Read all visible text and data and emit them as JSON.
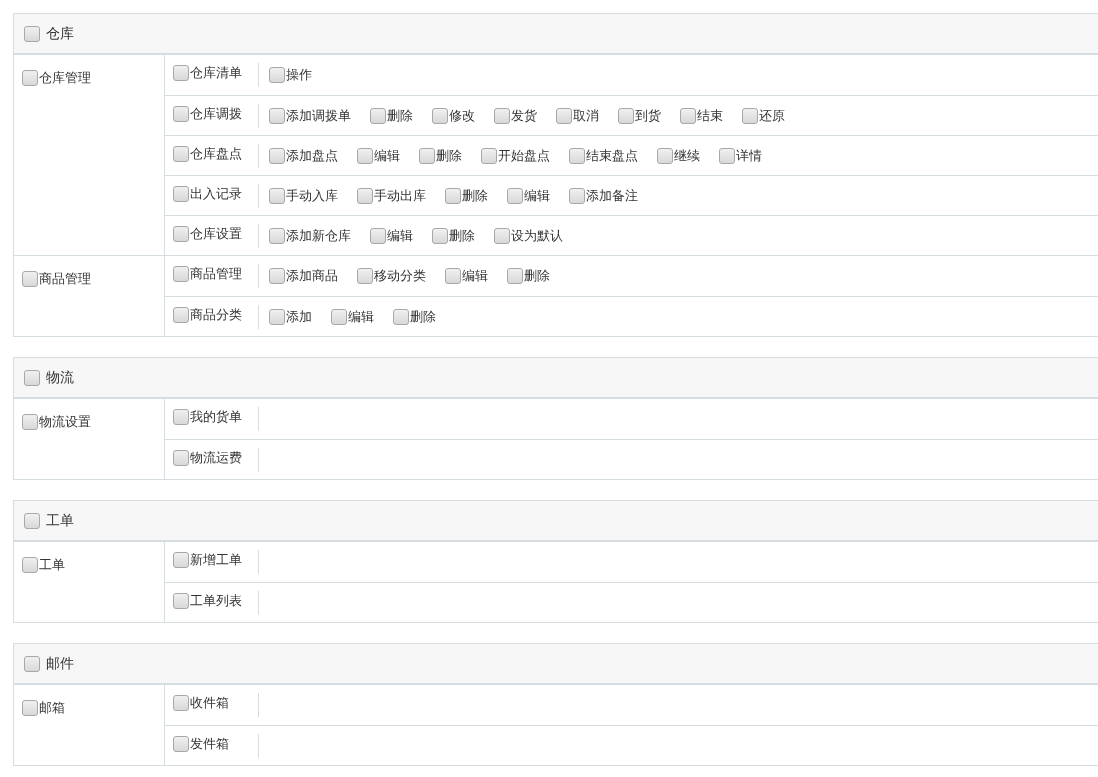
{
  "sections": [
    {
      "title": "仓库",
      "checked": false,
      "groups": [
        {
          "label": "仓库管理",
          "checked": false,
          "rows": [
            {
              "label": "仓库清单",
              "checked": false,
              "actions": [
                {
                  "label": "操作",
                  "checked": false
                }
              ]
            },
            {
              "label": "仓库调拨",
              "checked": false,
              "actions": [
                {
                  "label": "添加调拨单",
                  "checked": false
                },
                {
                  "label": "删除",
                  "checked": false
                },
                {
                  "label": "修改",
                  "checked": false
                },
                {
                  "label": "发货",
                  "checked": false
                },
                {
                  "label": "取消",
                  "checked": false
                },
                {
                  "label": "到货",
                  "checked": false
                },
                {
                  "label": "结束",
                  "checked": false
                },
                {
                  "label": "还原",
                  "checked": false
                }
              ]
            },
            {
              "label": "仓库盘点",
              "checked": false,
              "actions": [
                {
                  "label": "添加盘点",
                  "checked": false
                },
                {
                  "label": "编辑",
                  "checked": false
                },
                {
                  "label": "删除",
                  "checked": false
                },
                {
                  "label": "开始盘点",
                  "checked": false
                },
                {
                  "label": "结束盘点",
                  "checked": false
                },
                {
                  "label": "继续",
                  "checked": false
                },
                {
                  "label": "详情",
                  "checked": false
                }
              ]
            },
            {
              "label": "出入记录",
              "checked": false,
              "actions": [
                {
                  "label": "手动入库",
                  "checked": false
                },
                {
                  "label": "手动出库",
                  "checked": false
                },
                {
                  "label": "删除",
                  "checked": false
                },
                {
                  "label": "编辑",
                  "checked": false
                },
                {
                  "label": "添加备注",
                  "checked": false
                }
              ]
            },
            {
              "label": "仓库设置",
              "checked": false,
              "actions": [
                {
                  "label": "添加新仓库",
                  "checked": false
                },
                {
                  "label": "编辑",
                  "checked": false
                },
                {
                  "label": "删除",
                  "checked": false
                },
                {
                  "label": "设为默认",
                  "checked": false
                }
              ]
            }
          ]
        },
        {
          "label": "商品管理",
          "checked": false,
          "rows": [
            {
              "label": "商品管理",
              "checked": false,
              "actions": [
                {
                  "label": "添加商品",
                  "checked": false
                },
                {
                  "label": "移动分类",
                  "checked": false
                },
                {
                  "label": "编辑",
                  "checked": false
                },
                {
                  "label": "删除",
                  "checked": false
                }
              ]
            },
            {
              "label": "商品分类",
              "checked": false,
              "actions": [
                {
                  "label": "添加",
                  "checked": false
                },
                {
                  "label": "编辑",
                  "checked": false
                },
                {
                  "label": "删除",
                  "checked": false
                }
              ]
            }
          ]
        }
      ]
    },
    {
      "title": "物流",
      "checked": false,
      "groups": [
        {
          "label": "物流设置",
          "checked": false,
          "rows": [
            {
              "label": "我的货单",
              "checked": false,
              "actions": []
            },
            {
              "label": "物流运费",
              "checked": false,
              "actions": []
            }
          ]
        }
      ]
    },
    {
      "title": "工单",
      "checked": false,
      "groups": [
        {
          "label": "工单",
          "checked": false,
          "rows": [
            {
              "label": "新增工单",
              "checked": false,
              "actions": []
            },
            {
              "label": "工单列表",
              "checked": false,
              "actions": []
            }
          ]
        }
      ]
    },
    {
      "title": "邮件",
      "checked": false,
      "groups": [
        {
          "label": "邮箱",
          "checked": false,
          "rows": [
            {
              "label": "收件箱",
              "checked": false,
              "actions": []
            },
            {
              "label": "发件箱",
              "checked": false,
              "actions": []
            }
          ]
        }
      ]
    }
  ]
}
